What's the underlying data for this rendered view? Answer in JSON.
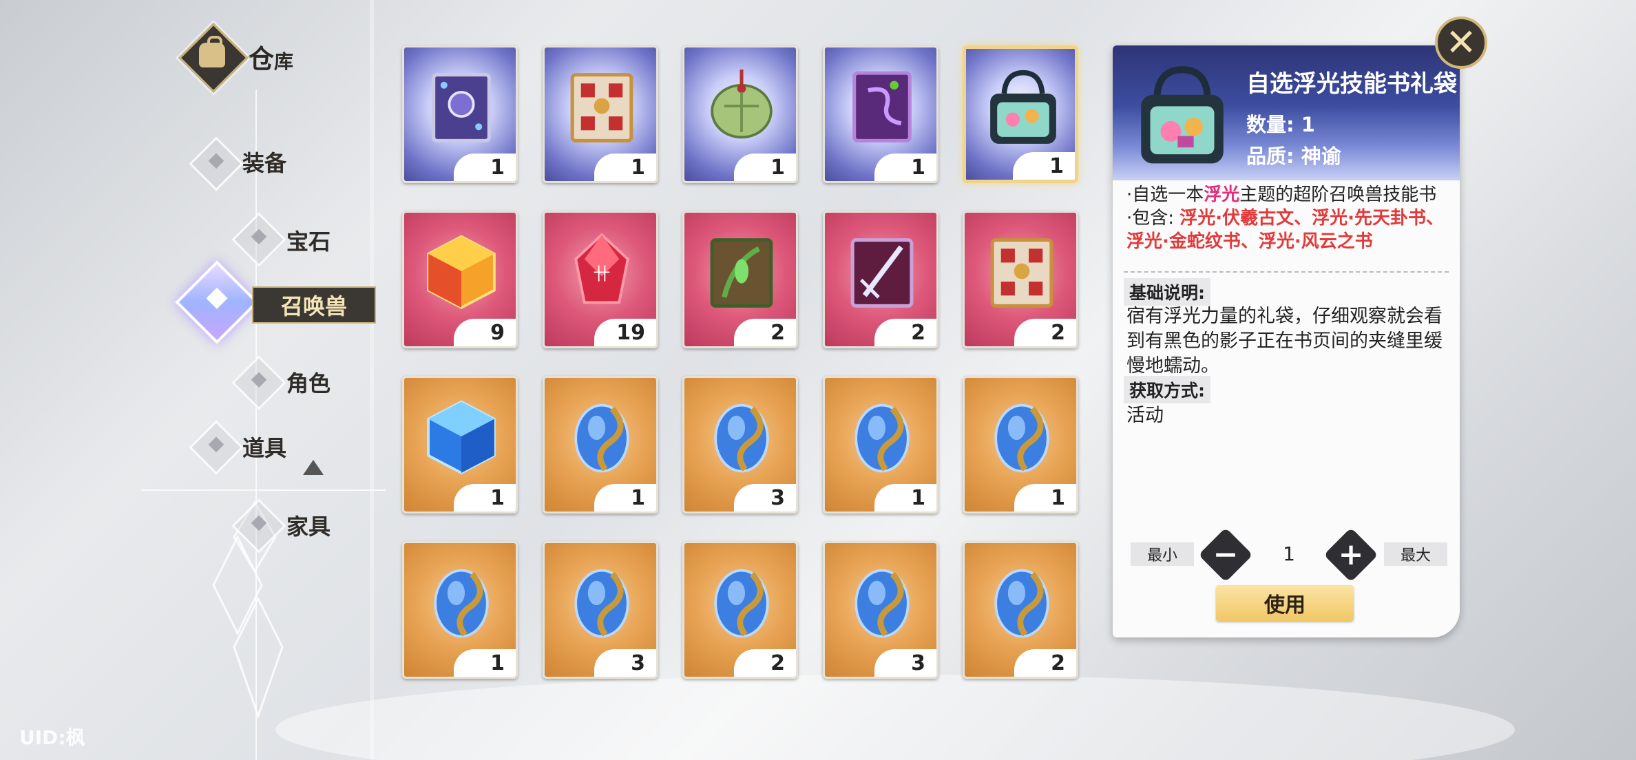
{
  "nav": {
    "title_main": "仓",
    "title_sub": "库",
    "items": [
      {
        "label": "装备"
      },
      {
        "label": "宝石"
      },
      {
        "label": "召唤兽",
        "active": true
      },
      {
        "label": "角色"
      },
      {
        "label": "道具"
      },
      {
        "label": "家具"
      }
    ]
  },
  "uid": "UID:枫",
  "grid": {
    "rows": [
      [
        {
          "art": "purple-magic-book-icon",
          "quality": "purple",
          "count": "1"
        },
        {
          "art": "red-gold-book-icon",
          "quality": "purple",
          "count": "1"
        },
        {
          "art": "green-tortoise-shell-icon",
          "quality": "purple",
          "count": "1"
        },
        {
          "art": "purple-swirl-book-icon",
          "quality": "purple",
          "count": "1"
        },
        {
          "art": "gift-bag-icon",
          "quality": "purple",
          "count": "1",
          "selected": true
        }
      ],
      [
        {
          "art": "fire-cube-icon",
          "quality": "red",
          "count": "9"
        },
        {
          "art": "red-crystal-icon",
          "quality": "red",
          "count": "19"
        },
        {
          "art": "green-vine-book-icon",
          "quality": "red",
          "count": "2"
        },
        {
          "art": "purple-sword-book-icon",
          "quality": "red",
          "count": "2"
        },
        {
          "art": "red-gold-book-icon",
          "quality": "red",
          "count": "2"
        }
      ],
      [
        {
          "art": "blue-ice-cube-icon",
          "quality": "orange",
          "count": "1"
        },
        {
          "art": "blue-gem-icon",
          "quality": "orange",
          "count": "1"
        },
        {
          "art": "blue-gem-icon",
          "quality": "orange",
          "count": "3"
        },
        {
          "art": "blue-gem-icon",
          "quality": "orange",
          "count": "1"
        },
        {
          "art": "blue-gem-icon",
          "quality": "orange",
          "count": "1"
        }
      ],
      [
        {
          "art": "blue-gem-icon",
          "quality": "orange",
          "count": "1"
        },
        {
          "art": "blue-gem-icon",
          "quality": "orange",
          "count": "3"
        },
        {
          "art": "blue-gem-icon",
          "quality": "orange",
          "count": "2"
        },
        {
          "art": "blue-gem-icon",
          "quality": "orange",
          "count": "3"
        },
        {
          "art": "blue-gem-icon",
          "quality": "orange",
          "count": "2"
        }
      ]
    ]
  },
  "detail": {
    "title": "自选浮光技能书礼袋",
    "quantity": "数量: 1",
    "quality": "品质: 神谕",
    "desc_prefix": "·自选一本",
    "desc_highlight": "浮光",
    "desc_suffix": "主题的超阶召唤兽技能书",
    "contains_label": "·包含:",
    "contains_items": "浮光·伏羲古文、浮光·先天卦书、浮光·金蛇纹书、浮光·风云之书",
    "basic_label": "基础说明:",
    "basic_text": "宿有浮光力量的礼袋，仔细观察就会看到有黑色的影子正在书页间的夹缝里缓慢地蠕动。",
    "obtain_label": "获取方式:",
    "obtain_text": "活动",
    "min_label": "最小",
    "max_label": "最大",
    "qty_value": "1",
    "minus": "−",
    "plus": "+",
    "use_label": "使用"
  },
  "close": "✕",
  "colors": {
    "gold": "#d2b77a",
    "dark": "#3a352f",
    "highlight_pink": "#e0307c",
    "highlight_red": "#e23a3a"
  }
}
